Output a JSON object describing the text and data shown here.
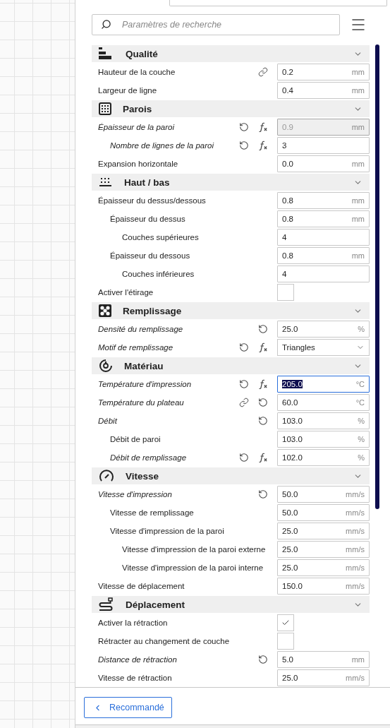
{
  "search": {
    "placeholder": "Paramètres de recherche"
  },
  "sections": [
    {
      "title": "Qualité",
      "expanded": true,
      "settings": [
        {
          "label": "Hauteur de la couche",
          "kind": "number",
          "value": "0.2",
          "unit": "mm",
          "modified": false,
          "linked": true
        },
        {
          "label": "Largeur de ligne",
          "kind": "number",
          "value": "0.4",
          "unit": "mm",
          "modified": false
        }
      ]
    },
    {
      "title": "Parois",
      "expanded": true,
      "settings": [
        {
          "label": "Épaisseur de la paroi",
          "kind": "number",
          "value": "0.9",
          "unit": "mm",
          "modified": true,
          "reset": true,
          "formula": true,
          "disabled": true,
          "children": [
            {
              "label": "Nombre de lignes de la paroi",
              "kind": "number",
              "value": "3",
              "modified": true,
              "reset": true,
              "formula": true
            }
          ]
        },
        {
          "label": "Expansion horizontale",
          "kind": "number",
          "value": "0.0",
          "unit": "mm",
          "modified": false
        }
      ]
    },
    {
      "title": "Haut / bas",
      "expanded": true,
      "settings": [
        {
          "label": "Épaisseur du dessus/dessous",
          "kind": "number",
          "value": "0.8",
          "unit": "mm",
          "modified": false,
          "children": [
            {
              "label": "Épaisseur du dessus",
              "kind": "number",
              "value": "0.8",
              "unit": "mm",
              "modified": false,
              "children": [
                {
                  "label": "Couches supérieures",
                  "kind": "number",
                  "value": "4",
                  "modified": false
                }
              ]
            },
            {
              "label": "Épaisseur du dessous",
              "kind": "number",
              "value": "0.8",
              "unit": "mm",
              "modified": false,
              "children": [
                {
                  "label": "Couches inférieures",
                  "kind": "number",
                  "value": "4",
                  "modified": false
                }
              ]
            }
          ]
        },
        {
          "label": "Activer l'étirage",
          "kind": "checkbox",
          "checked": false,
          "modified": false
        }
      ]
    },
    {
      "title": "Remplissage",
      "expanded": true,
      "settings": [
        {
          "label": "Densité du remplissage",
          "kind": "number",
          "value": "25.0",
          "unit": "%",
          "modified": true,
          "reset": true
        },
        {
          "label": "Motif de remplissage",
          "kind": "dropdown",
          "value": "Triangles",
          "modified": true,
          "reset": true,
          "formula": true
        }
      ]
    },
    {
      "title": "Matériau",
      "expanded": true,
      "settings": [
        {
          "label": "Température d'impression",
          "kind": "number",
          "value": "205.0",
          "unit": "°C",
          "modified": true,
          "reset": true,
          "formula": true,
          "focused": true
        },
        {
          "label": "Température du plateau",
          "kind": "number",
          "value": "60.0",
          "unit": "°C",
          "modified": true,
          "linked": true,
          "reset": true
        },
        {
          "label": "Débit",
          "kind": "number",
          "value": "103.0",
          "unit": "%",
          "modified": true,
          "reset": true,
          "children": [
            {
              "label": "Débit de paroi",
              "kind": "number",
              "value": "103.0",
              "unit": "%",
              "modified": false
            },
            {
              "label": "Débit de remplissage",
              "kind": "number",
              "value": "102.0",
              "unit": "%",
              "modified": true,
              "reset": true,
              "formula": true
            }
          ]
        }
      ]
    },
    {
      "title": "Vitesse",
      "expanded": true,
      "settings": [
        {
          "label": "Vitesse d'impression",
          "kind": "number",
          "value": "50.0",
          "unit": "mm/s",
          "modified": true,
          "reset": true,
          "children": [
            {
              "label": "Vitesse de remplissage",
              "kind": "number",
              "value": "50.0",
              "unit": "mm/s",
              "modified": false
            },
            {
              "label": "Vitesse d'impression de la paroi",
              "kind": "number",
              "value": "25.0",
              "unit": "mm/s",
              "modified": false,
              "children": [
                {
                  "label": "Vitesse d'impression de la paroi externe",
                  "kind": "number",
                  "value": "25.0",
                  "unit": "mm/s",
                  "modified": false
                },
                {
                  "label": "Vitesse d'impression de la paroi interne",
                  "kind": "number",
                  "value": "25.0",
                  "unit": "mm/s",
                  "modified": false
                }
              ]
            }
          ]
        },
        {
          "label": "Vitesse de déplacement",
          "kind": "number",
          "value": "150.0",
          "unit": "mm/s",
          "modified": false
        }
      ]
    },
    {
      "title": "Déplacement",
      "expanded": true,
      "settings": [
        {
          "label": "Activer la rétraction",
          "kind": "checkbox",
          "checked": true,
          "modified": false
        },
        {
          "label": "Rétracter au changement de couche",
          "kind": "checkbox",
          "checked": false,
          "modified": false
        },
        {
          "label": "Distance de rétraction",
          "kind": "number",
          "value": "5.0",
          "unit": "mm",
          "modified": true,
          "reset": true
        },
        {
          "label": "Vitesse de rétraction",
          "kind": "number",
          "value": "25.0",
          "unit": "mm/s",
          "modified": false
        }
      ]
    }
  ],
  "footer": {
    "button": "Recommandé"
  }
}
